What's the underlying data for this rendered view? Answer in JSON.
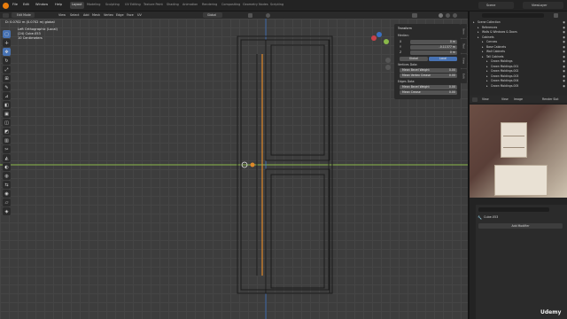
{
  "topbar": {
    "menus": [
      "File",
      "Edit",
      "Window",
      "Help"
    ],
    "workspaces": [
      "Layout",
      "Modeling",
      "Sculpting",
      "UV Editing",
      "Texture Paint",
      "Shading",
      "Animation",
      "Rendering",
      "Compositing",
      "Geometry Nodes",
      "Scripting"
    ],
    "active_workspace": "Layout",
    "scene_label": "Scene",
    "viewlayer_label": "ViewLayer"
  },
  "viewport_header": {
    "mode": "Edit Mode",
    "menus": [
      "View",
      "Select",
      "Add",
      "Mesh",
      "Vertex",
      "Edge",
      "Face",
      "UV"
    ],
    "orientation": "Global"
  },
  "viewport_overlay": {
    "stats": "D: 0.0702 m (0.0702 m) global",
    "view_name": "Left Orthographic (Local)",
    "object": "(24) Cube.053",
    "units": "10 Centimeters"
  },
  "npanel": {
    "tabs": [
      "Item",
      "Tool",
      "View",
      "Edit"
    ],
    "transform_title": "Transform",
    "median_label": "Median:",
    "x_label": "X",
    "x_value": "0 m",
    "y_label": "Y",
    "y_value": "-0.11377 m",
    "z_label": "Z",
    "z_value": "0 m",
    "global_label": "Global",
    "local_label": "Local",
    "vertices_data_label": "Vertices Data:",
    "mean_bevel_weight_label": "Mean Bevel Weight",
    "mean_bevel_weight_value": "0.00",
    "mean_vertex_crease_label": "Mean Vertex Crease",
    "mean_vertex_crease_value": "0.00",
    "edges_data_label": "Edges Data:",
    "edge_bevel_weight_label": "Mean Bevel Weight",
    "edge_bevel_weight_value": "0.00",
    "edge_crease_label": "Mean Crease",
    "edge_crease_value": "0.00"
  },
  "outliner": {
    "rows": [
      {
        "label": "Scene Collection",
        "indent": 0
      },
      {
        "label": "References",
        "indent": 1
      },
      {
        "label": "Walls & Windows & Doors",
        "indent": 1
      },
      {
        "label": "Cabinets",
        "indent": 1
      },
      {
        "label": "Carcass",
        "indent": 2
      },
      {
        "label": "Base Cabinets",
        "indent": 2
      },
      {
        "label": "Wall Cabinets",
        "indent": 2
      },
      {
        "label": "Tall Cabinets",
        "indent": 2
      },
      {
        "label": "Crown Moldings",
        "indent": 3
      },
      {
        "label": "Crown Moldings.001",
        "indent": 3
      },
      {
        "label": "Crown Moldings.002",
        "indent": 3
      },
      {
        "label": "Crown Moldings.003",
        "indent": 3
      },
      {
        "label": "Crown Moldings.004",
        "indent": 3
      },
      {
        "label": "Crown Moldings.005",
        "indent": 3
      }
    ]
  },
  "image_editor": {
    "menus": [
      "View",
      "View",
      "Image"
    ],
    "render_slot": "Render Slot"
  },
  "properties": {
    "object_name": "Cube.053",
    "add_modifier": "Add Modifier"
  },
  "watermark": "Udemy",
  "colors": {
    "accent": "#4772b3",
    "grid": "#454545",
    "viewport_bg": "#3d3d3d",
    "axis_green": "#8ab94a",
    "axis_blue": "#3a6fc0",
    "edge_orange": "#e0892a"
  }
}
